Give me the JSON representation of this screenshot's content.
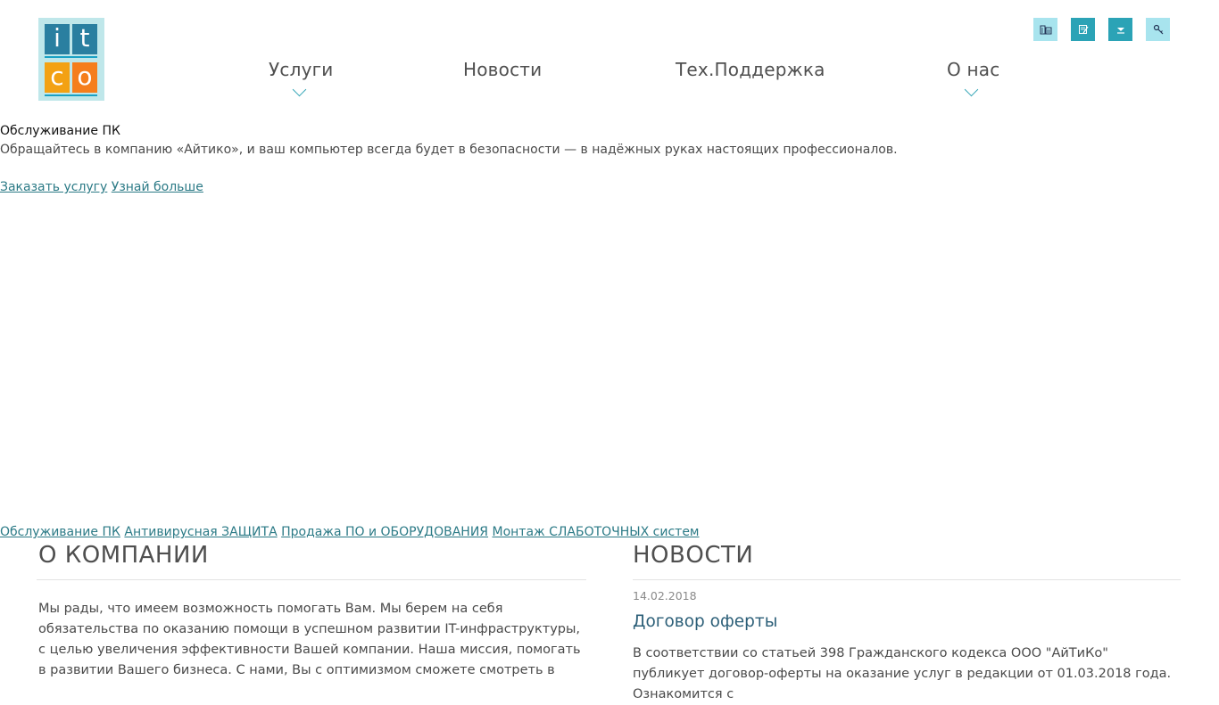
{
  "logo": {
    "letters": [
      "i",
      "t",
      "c",
      "o"
    ]
  },
  "top_icons": [
    "building-icon",
    "edit-icon",
    "download-icon",
    "key-icon"
  ],
  "nav": {
    "services": "Услуги",
    "news": "Новости",
    "support": "Тех.Поддержка",
    "about": "О нас"
  },
  "hero": {
    "title": "Обслуживание ПК",
    "description": "Обращайтесь в компанию «Айтико», и ваш компьютер всегда будет в безопасности — в надёжных руках настоящих профессионалов.",
    "order_link": "Заказать услугу",
    "more_link": "Узнай больше"
  },
  "services_links": [
    "Обслуживание ПК",
    "Антивирусная ЗАЩИТА",
    "Продажа ПО и ОБОРУДОВАНИЯ",
    "Монтаж СЛАБОТОЧНЫХ систем"
  ],
  "about": {
    "heading": "О КОМПАНИИ",
    "text": "Мы рады, что имеем возможность помогать Вам. Мы берем на себя обязательства по оказанию помощи в успешном развитии IT-инфраструктуры, с целью увеличения эффективности Вашей компании. Наша миссия, помогать в развитии Вашего бизнеса. С нами, Вы с оптимизмом сможете смотреть в"
  },
  "news": {
    "heading": "НОВОСТИ",
    "date": "14.02.2018",
    "title": "Договор оферты",
    "text": "В соответствии со статьей 398 Гражданского кодекса ООО \"АйТиКо\" публикует договор-оферты на оказание услуг в редакции от 01.03.2018 года. Ознакомится с"
  },
  "colors": {
    "accent": "#36a6b7",
    "link": "#2b7a86",
    "logo_blue": "#2a7fa0",
    "logo_yellow": "#f3a113",
    "logo_orange": "#f57e1c"
  }
}
